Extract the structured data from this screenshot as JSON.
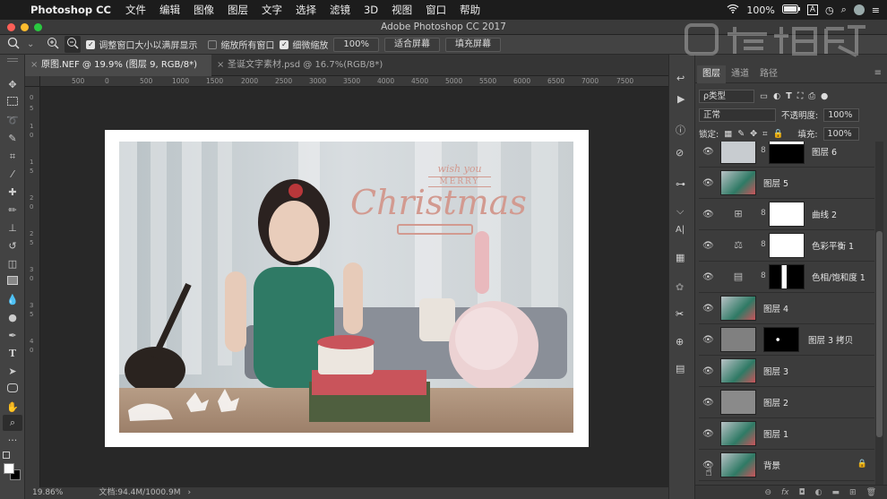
{
  "menubar": {
    "app_name": "Photoshop CC",
    "items": [
      "文件",
      "编辑",
      "图像",
      "图层",
      "文字",
      "选择",
      "滤镜",
      "3D",
      "视图",
      "窗口",
      "帮助"
    ],
    "battery": "100%"
  },
  "window": {
    "title": "Adobe Photoshop CC 2017"
  },
  "options": {
    "resize_windows": "调整窗口大小以满屏显示",
    "zoom_all": "缩放所有窗口",
    "scrubby_zoom": "细微缩放",
    "zoom_value": "100%",
    "fit_screen": "适合屏幕",
    "fill_screen": "填充屏幕"
  },
  "tabs": [
    {
      "label": "原图.NEF @ 19.9% (图层 9, RGB/8*) *"
    },
    {
      "label": "圣诞文字素材.psd @ 16.7%(RGB/8*)"
    }
  ],
  "ruler": {
    "h_ticks": [
      "500",
      "0",
      "500",
      "1000",
      "1500",
      "2000",
      "2500",
      "3000",
      "3500",
      "4000",
      "4500",
      "5000",
      "5500",
      "6000",
      "6500",
      "7000",
      "7500"
    ],
    "v_ticks": [
      "0",
      "5",
      "1",
      "0",
      "1",
      "5",
      "2",
      "0",
      "2",
      "5",
      "3",
      "0",
      "3",
      "5",
      "4",
      "0"
    ]
  },
  "artwork": {
    "line1": "wish you",
    "line2": "MERRY",
    "line3": "Christmas"
  },
  "status": {
    "zoom": "19.86%",
    "doc": "文档:94.4M/1000.9M"
  },
  "layers_panel": {
    "tabs": [
      "图层",
      "通道",
      "路径"
    ],
    "filter_kind": "ρ类型",
    "blend_mode": "正常",
    "opacity_label": "不透明度:",
    "opacity_value": "100%",
    "lock_label": "锁定:",
    "fill_label": "填充:",
    "fill_value": "100%",
    "layers": [
      {
        "name": "图层 6",
        "kind": "pixel_mask"
      },
      {
        "name": "图层 5",
        "kind": "photo"
      },
      {
        "name": "曲线 2",
        "kind": "adjust_curves"
      },
      {
        "name": "色彩平衡 1",
        "kind": "adjust_balance"
      },
      {
        "name": "色相/饱和度 1",
        "kind": "adjust_hue"
      },
      {
        "name": "图层 4",
        "kind": "photo"
      },
      {
        "name": "图层 3 拷贝",
        "kind": "gray_mask"
      },
      {
        "name": "图层 3",
        "kind": "photo"
      },
      {
        "name": "图层 2",
        "kind": "gray"
      },
      {
        "name": "图层 1",
        "kind": "photo"
      },
      {
        "name": "背景",
        "kind": "photo_locked"
      }
    ]
  },
  "colors": {
    "accent": "#e8b9b0",
    "text_rose": "#d29a90"
  }
}
